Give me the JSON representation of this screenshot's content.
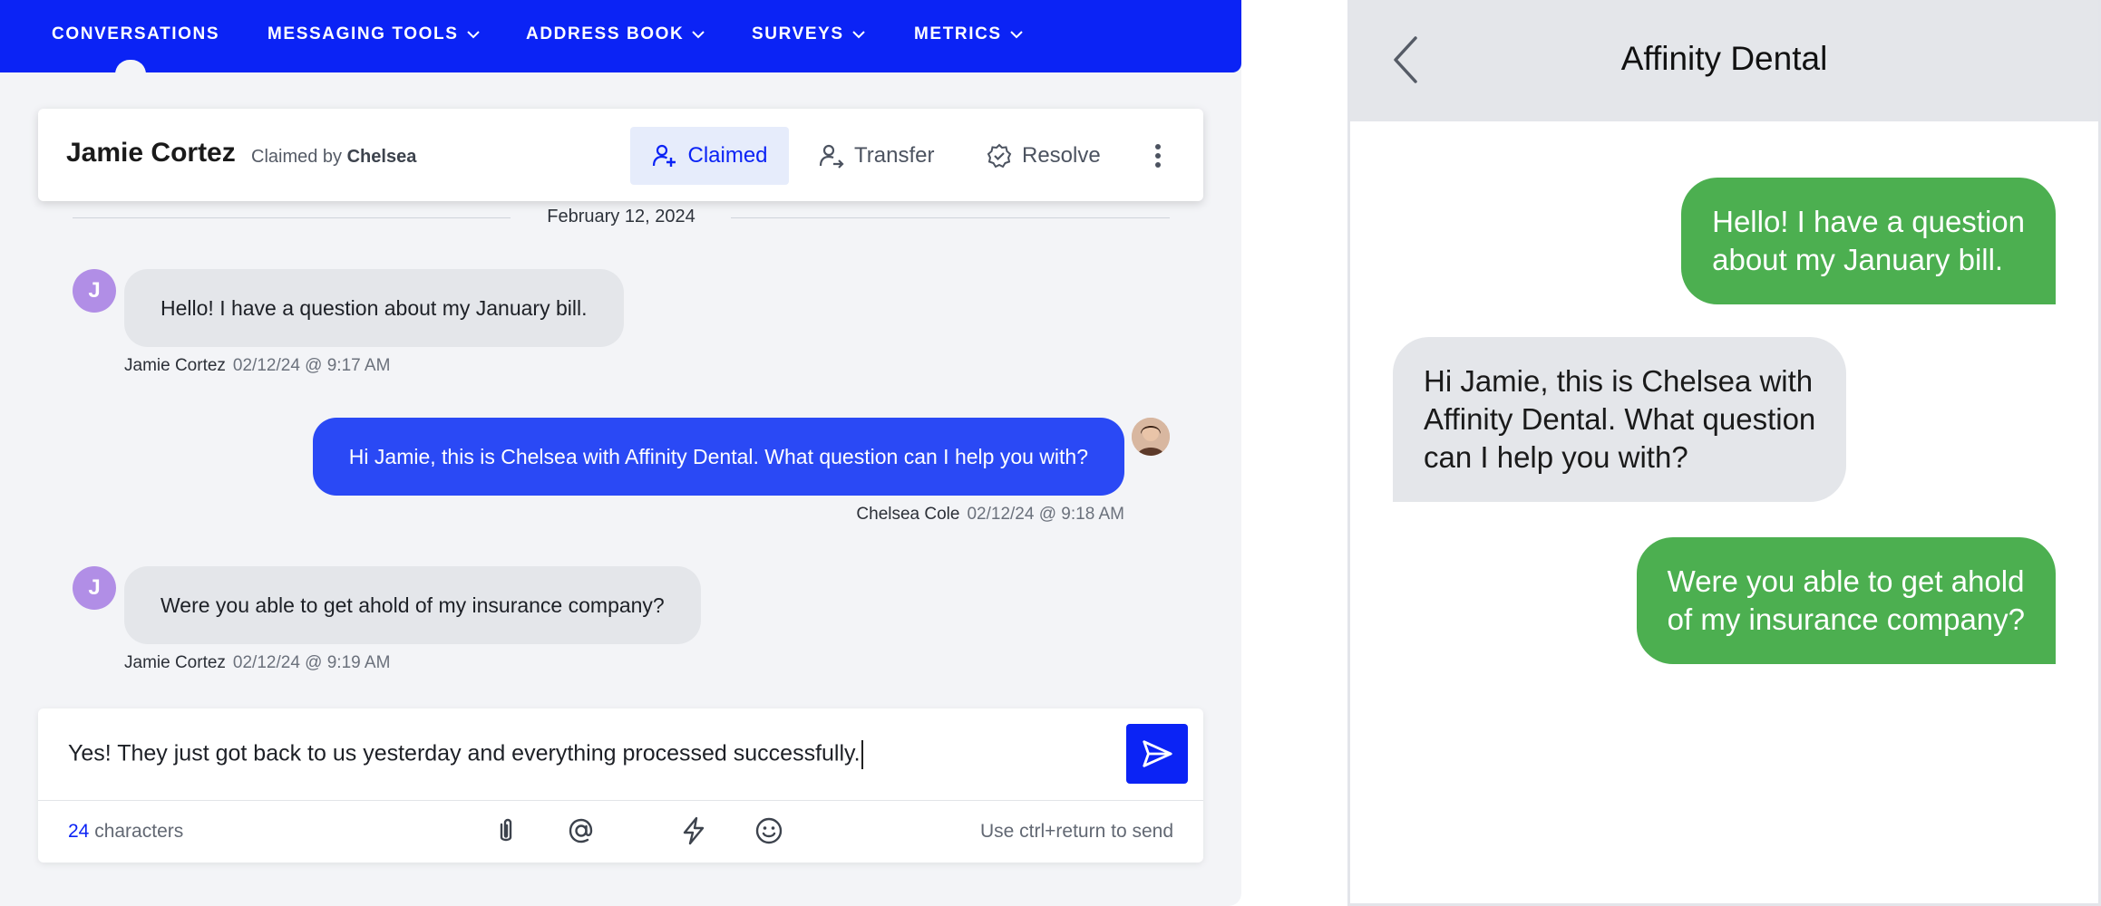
{
  "nav": {
    "items": [
      {
        "label": "CONVERSATIONS",
        "active": true,
        "dropdown": false
      },
      {
        "label": "MESSAGING TOOLS",
        "dropdown": true
      },
      {
        "label": "ADDRESS BOOK",
        "dropdown": true
      },
      {
        "label": "SURVEYS",
        "dropdown": true
      },
      {
        "label": "METRICS",
        "dropdown": true
      }
    ]
  },
  "conversation": {
    "contact_name": "Jamie Cortez",
    "claimed_prefix": "Claimed by",
    "claimed_agent": "Chelsea",
    "actions": {
      "claimed": "Claimed",
      "transfer": "Transfer",
      "resolve": "Resolve"
    },
    "date": "February 12, 2024",
    "messages": [
      {
        "direction": "in",
        "avatar_initial": "J",
        "text": "Hello! I have a question about my January bill.",
        "sender": "Jamie Cortez",
        "time": "02/12/24 @ 9:17 AM"
      },
      {
        "direction": "out",
        "text": "Hi Jamie, this is Chelsea with Affinity Dental. What question can I help you with?",
        "sender": "Chelsea Cole",
        "time": "02/12/24 @ 9:18 AM"
      },
      {
        "direction": "in",
        "avatar_initial": "J",
        "text": "Were you able to get ahold of my insurance company?",
        "sender": "Jamie Cortez",
        "time": "02/12/24 @ 9:19 AM"
      }
    ]
  },
  "composer": {
    "draft": "Yes! They just got back to us yesterday and everything processed successfully.",
    "char_count": "24",
    "char_label": "characters",
    "hint": "Use ctrl+return to send",
    "tools": [
      "paperclip-icon",
      "at-sign-icon",
      "lightning-icon",
      "smiley-icon"
    ]
  },
  "phone": {
    "title": "Affinity Dental",
    "messages": [
      {
        "direction": "out",
        "lines": [
          "Hello! I have a question",
          "about my January bill."
        ]
      },
      {
        "direction": "in",
        "lines": [
          "Hi Jamie, this is Chelsea with",
          "Affinity Dental. What question",
          "can I help you with?"
        ]
      },
      {
        "direction": "out",
        "lines": [
          "Were you able to get ahold",
          "of my insurance company?"
        ]
      }
    ]
  },
  "colors": {
    "brand_blue": "#0b23f5",
    "outgoing_bubble": "#2a49f5",
    "incoming_bubble": "#e4e6ea",
    "sms_green": "#4caf50",
    "avatar_purple": "#b18ee6"
  }
}
